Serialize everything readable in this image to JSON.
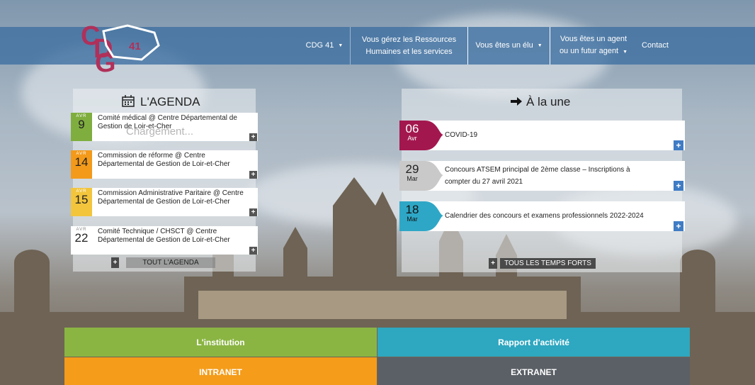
{
  "logo": {
    "letters": [
      "C",
      "D",
      "G"
    ],
    "number": "41"
  },
  "nav": {
    "cdg41": "CDG 41",
    "rh_line1": "Vous gérez les Ressources",
    "rh_line2": "Humaines et les services",
    "elu": "Vous êtes un élu",
    "agent_line1": "Vous êtes un agent",
    "agent_line2": "ou un futur agent",
    "contact": "Contact",
    "arrow": "▼"
  },
  "agenda": {
    "title": "L'AGENDA",
    "loading": "Chargement...",
    "items": [
      {
        "month": "AVR",
        "day": "9",
        "text": "Comité médical @ Centre Départemental de Gestion de Loir-et-Cher",
        "color": "#7fae3f"
      },
      {
        "month": "AVR",
        "day": "14",
        "text": "Commission de réforme @ Centre Départemental de Gestion de Loir-et-Cher",
        "color": "#f39a1a"
      },
      {
        "month": "AVR",
        "day": "15",
        "text": "Commission Administrative Paritaire @ Centre Départemental de Gestion de Loir-et-Cher",
        "color": "#f2c53d"
      },
      {
        "month": "AVR",
        "day": "22",
        "text": "Comité Technique / CHSCT @ Centre Départemental de Gestion de Loir-et-Cher",
        "color": "#ffffff"
      }
    ],
    "all_button": "TOUT L'AGENDA",
    "plus": "+"
  },
  "news": {
    "title": "À la une",
    "items": [
      {
        "day": "06",
        "month": "Avr",
        "text": "COVID-19",
        "color": "#a3174f"
      },
      {
        "day": "29",
        "month": "Mar",
        "text": "Concours ATSEM principal de 2ème classe – Inscriptions à compter du 27 avril 2021",
        "color": "#c9c9c9"
      },
      {
        "day": "18",
        "month": "Mar",
        "text": "Calendrier des concours et examens professionnels 2022-2024",
        "color": "#2ea7c6"
      }
    ],
    "all_button": "TOUS LES TEMPS FORTS",
    "plus": "+"
  },
  "tiles": {
    "institution": "L'institution",
    "rapport": "Rapport d'activité",
    "intranet": "INTRANET",
    "extranet": "EXTRANET"
  },
  "colors": {
    "institution": "#8ab543",
    "rapport": "#2ea7c0",
    "intranet": "#f59c1a",
    "extranet": "#5b6066"
  }
}
